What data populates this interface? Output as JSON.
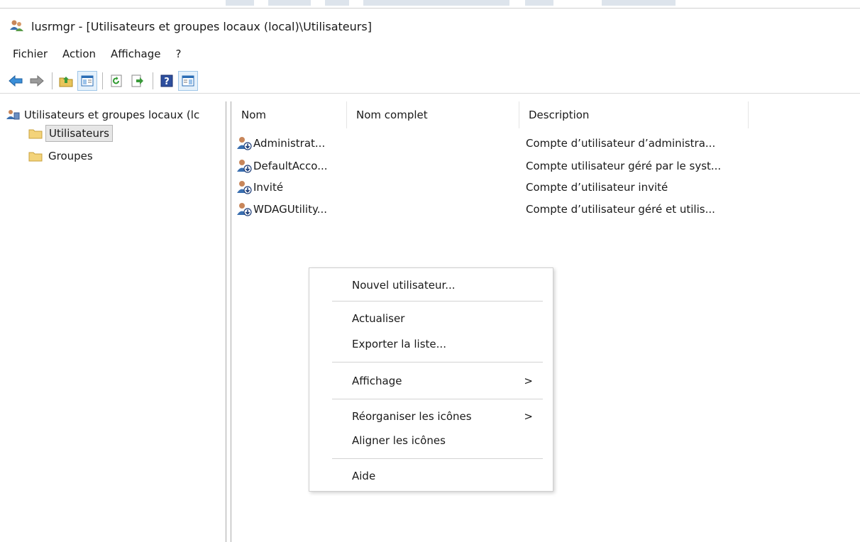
{
  "window": {
    "title": "lusrmgr - [Utilisateurs et groupes locaux (local)\\Utilisateurs]"
  },
  "menubar": {
    "items": [
      "Fichier",
      "Action",
      "Affichage",
      "?"
    ]
  },
  "toolbar": {
    "buttons": [
      "back-arrow-icon",
      "forward-arrow-icon",
      "up-folder-icon",
      "show-hide-tree-icon",
      "refresh-icon",
      "export-list-icon",
      "help-icon",
      "action-pane-icon"
    ]
  },
  "tree": {
    "root_label": "Utilisateurs et groupes locaux (lc",
    "items": [
      {
        "label": "Utilisateurs",
        "selected": true
      },
      {
        "label": "Groupes",
        "selected": false
      }
    ]
  },
  "list": {
    "columns": [
      "Nom",
      "Nom complet",
      "Description"
    ],
    "rows": [
      {
        "name": "Administrat...",
        "full_name": "",
        "description": "Compte d’utilisateur d’administra..."
      },
      {
        "name": "DefaultAcco...",
        "full_name": "",
        "description": "Compte utilisateur géré par le syst..."
      },
      {
        "name": "Invité",
        "full_name": "",
        "description": "Compte d’utilisateur invité"
      },
      {
        "name": "WDAGUtility...",
        "full_name": "",
        "description": "Compte d’utilisateur géré et utilis..."
      }
    ]
  },
  "context_menu": {
    "items": [
      {
        "label": "Nouvel utilisateur...",
        "submenu": false
      },
      {
        "label": "Actualiser",
        "submenu": false
      },
      {
        "label": "Exporter la liste...",
        "submenu": false
      },
      {
        "label": "Affichage",
        "submenu": true
      },
      {
        "label": "Réorganiser les icônes",
        "submenu": true
      },
      {
        "label": "Aligner les icônes",
        "submenu": false
      },
      {
        "label": "Aide",
        "submenu": false
      }
    ],
    "submenu_arrow": ">"
  },
  "colors": {
    "selection_bg": "#e6e6e6",
    "pressed_button_bg": "#e5f1fb",
    "separator": "#d3d3d3"
  }
}
